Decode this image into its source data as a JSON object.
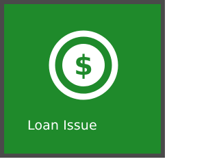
{
  "tile": {
    "label": "Loan Issue",
    "icon": "dollar-coin-icon",
    "background_color": "#1f8a2b",
    "border_color": "#4a4a4a",
    "icon_glyph": "$"
  }
}
